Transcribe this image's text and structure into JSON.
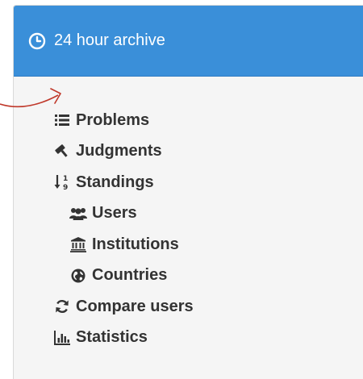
{
  "header": {
    "title": "24 hour archive",
    "icon": "clock-icon",
    "background_color": "#3a8fd9"
  },
  "menu": {
    "items": [
      {
        "label": "Problems",
        "icon": "list-icon"
      },
      {
        "label": "Judgments",
        "icon": "gavel-icon"
      },
      {
        "label": "Standings",
        "icon": "sort-numeric-icon"
      },
      {
        "label": "Users",
        "icon": "users-icon"
      },
      {
        "label": "Institutions",
        "icon": "institution-icon"
      },
      {
        "label": "Countries",
        "icon": "globe-icon"
      },
      {
        "label": "Compare users",
        "icon": "refresh-icon"
      },
      {
        "label": "Statistics",
        "icon": "bar-chart-icon"
      }
    ]
  },
  "annotation": {
    "arrow_color": "#c0392b",
    "points_to": "Problems"
  }
}
